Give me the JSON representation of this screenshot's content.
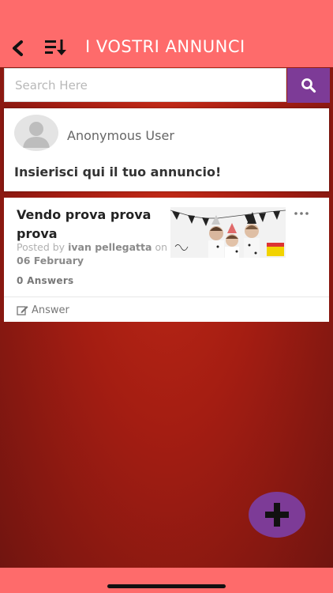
{
  "header": {
    "title": "I VOSTRI ANNUNCI",
    "back_icon": "back-arrow-icon",
    "sort_icon": "sort-list-icon"
  },
  "search": {
    "placeholder": "Search Here",
    "value": "",
    "button_icon": "search-icon"
  },
  "composer": {
    "user_name": "Anonymous User",
    "prompt": "Insierisci qui il tuo annuncio!"
  },
  "posts": [
    {
      "title": "Vendo prova prova prova",
      "posted_by_label": "Posted by",
      "author": "ivan pellegatta",
      "on_label": "on",
      "date": "06 February",
      "answers": "0 Answers",
      "answer_label": "Answer",
      "more_icon": "more-dots-icon"
    }
  ],
  "fab": {
    "icon": "plus-icon"
  },
  "colors": {
    "accent": "#fe6b6b",
    "purple": "#7d3b97",
    "background_dark": "#a41d12"
  }
}
